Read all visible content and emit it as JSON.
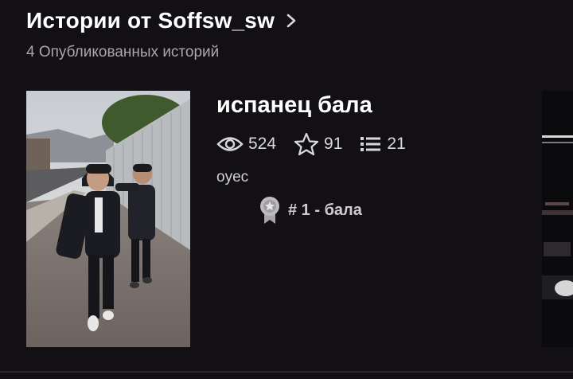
{
  "header": {
    "title": "Истории от Soffsw_sw",
    "subtitle": "4 Опубликованных историй"
  },
  "story": {
    "title": "испанец бала",
    "views": "524",
    "votes": "91",
    "parts": "21",
    "description": "oyec",
    "rank": "# 1 - бала"
  },
  "icons": {
    "header_chevron": "chevron-right-icon",
    "views": "eye-icon",
    "votes": "star-icon",
    "parts": "list-icon",
    "rank": "ribbon-badge-icon"
  }
}
